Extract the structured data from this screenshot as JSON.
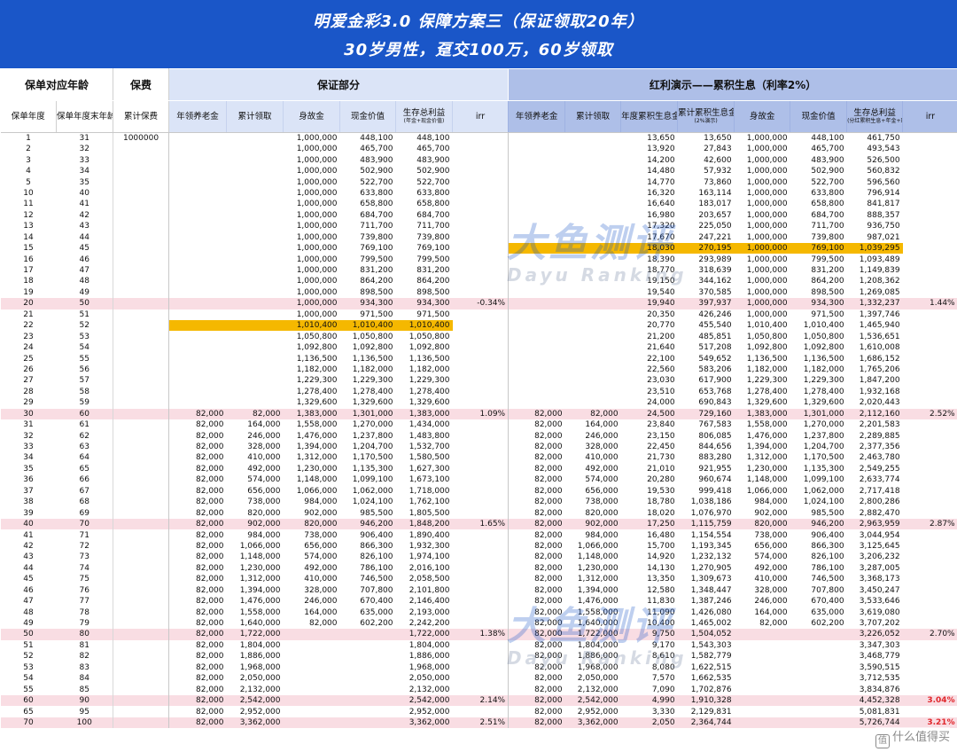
{
  "title": {
    "line1": "明爱金彩3.0  保障方案三（保证领取20年）",
    "line2": "30岁男性，趸交100万，60岁领取"
  },
  "groups": {
    "age": "保单对应年龄",
    "premium": "保费",
    "guaranteed": "保证部分",
    "dividend": "红利演示——累积生息（利率2%）"
  },
  "headers": [
    {
      "label": "保单年度"
    },
    {
      "label": "保单年度末年龄"
    },
    {
      "label": "累计保费"
    },
    {
      "label": "年领养老金"
    },
    {
      "label": "累计领取"
    },
    {
      "label": "身故金"
    },
    {
      "label": "现金价值"
    },
    {
      "label": "生存总利益",
      "sub": "(年金+现金价值)"
    },
    {
      "label": "irr"
    },
    {
      "label": "年领养老金"
    },
    {
      "label": "累计领取"
    },
    {
      "label": "年度累积生息金额"
    },
    {
      "label": "累计累积生息金额",
      "sub": "(2%演示)"
    },
    {
      "label": "身故金"
    },
    {
      "label": "现金价值"
    },
    {
      "label": "生存总利益",
      "sub": "(分红累积生息+年金+现价)"
    },
    {
      "label": "irr"
    }
  ],
  "rows": [
    [
      "1",
      "31",
      "1000000",
      "",
      "",
      "1,000,000",
      "448,100",
      "448,100",
      "",
      "",
      "",
      "13,650",
      "13,650",
      "1,000,000",
      "448,100",
      "461,750",
      ""
    ],
    [
      "2",
      "32",
      "",
      "",
      "",
      "1,000,000",
      "465,700",
      "465,700",
      "",
      "",
      "",
      "13,920",
      "27,843",
      "1,000,000",
      "465,700",
      "493,543",
      ""
    ],
    [
      "3",
      "33",
      "",
      "",
      "",
      "1,000,000",
      "483,900",
      "483,900",
      "",
      "",
      "",
      "14,200",
      "42,600",
      "1,000,000",
      "483,900",
      "526,500",
      ""
    ],
    [
      "4",
      "34",
      "",
      "",
      "",
      "1,000,000",
      "502,900",
      "502,900",
      "",
      "",
      "",
      "14,480",
      "57,932",
      "1,000,000",
      "502,900",
      "560,832",
      ""
    ],
    [
      "5",
      "35",
      "",
      "",
      "",
      "1,000,000",
      "522,700",
      "522,700",
      "",
      "",
      "",
      "14,770",
      "73,860",
      "1,000,000",
      "522,700",
      "596,560",
      ""
    ],
    [
      "10",
      "40",
      "",
      "",
      "",
      "1,000,000",
      "633,800",
      "633,800",
      "",
      "",
      "",
      "16,320",
      "163,114",
      "1,000,000",
      "633,800",
      "796,914",
      ""
    ],
    [
      "11",
      "41",
      "",
      "",
      "",
      "1,000,000",
      "658,800",
      "658,800",
      "",
      "",
      "",
      "16,640",
      "183,017",
      "1,000,000",
      "658,800",
      "841,817",
      ""
    ],
    [
      "12",
      "42",
      "",
      "",
      "",
      "1,000,000",
      "684,700",
      "684,700",
      "",
      "",
      "",
      "16,980",
      "203,657",
      "1,000,000",
      "684,700",
      "888,357",
      ""
    ],
    [
      "13",
      "43",
      "",
      "",
      "",
      "1,000,000",
      "711,700",
      "711,700",
      "",
      "",
      "",
      "17,320",
      "225,050",
      "1,000,000",
      "711,700",
      "936,750",
      ""
    ],
    [
      "14",
      "44",
      "",
      "",
      "",
      "1,000,000",
      "739,800",
      "739,800",
      "",
      "",
      "",
      "17,670",
      "247,221",
      "1,000,000",
      "739,800",
      "987,021",
      ""
    ],
    [
      "15",
      "45",
      "",
      "",
      "",
      "1,000,000",
      "769,100",
      "769,100",
      "",
      "",
      "",
      "18,030",
      "270,195",
      "1,000,000",
      "769,100",
      "1,039,295",
      ""
    ],
    [
      "16",
      "46",
      "",
      "",
      "",
      "1,000,000",
      "799,500",
      "799,500",
      "",
      "",
      "",
      "18,390",
      "293,989",
      "1,000,000",
      "799,500",
      "1,093,489",
      ""
    ],
    [
      "17",
      "47",
      "",
      "",
      "",
      "1,000,000",
      "831,200",
      "831,200",
      "",
      "",
      "",
      "18,770",
      "318,639",
      "1,000,000",
      "831,200",
      "1,149,839",
      ""
    ],
    [
      "18",
      "48",
      "",
      "",
      "",
      "1,000,000",
      "864,200",
      "864,200",
      "",
      "",
      "",
      "19,150",
      "344,162",
      "1,000,000",
      "864,200",
      "1,208,362",
      ""
    ],
    [
      "19",
      "49",
      "",
      "",
      "",
      "1,000,000",
      "898,500",
      "898,500",
      "",
      "",
      "",
      "19,540",
      "370,585",
      "1,000,000",
      "898,500",
      "1,269,085",
      ""
    ],
    [
      "20",
      "50",
      "",
      "",
      "",
      "1,000,000",
      "934,300",
      "934,300",
      "-0.34%",
      "",
      "",
      "19,940",
      "397,937",
      "1,000,000",
      "934,300",
      "1,332,237",
      "1.44%"
    ],
    [
      "21",
      "51",
      "",
      "",
      "",
      "1,000,000",
      "971,500",
      "971,500",
      "",
      "",
      "",
      "20,350",
      "426,246",
      "1,000,000",
      "971,500",
      "1,397,746",
      ""
    ],
    [
      "22",
      "52",
      "",
      "",
      "",
      "1,010,400",
      "1,010,400",
      "1,010,400",
      "",
      "",
      "",
      "20,770",
      "455,540",
      "1,010,400",
      "1,010,400",
      "1,465,940",
      ""
    ],
    [
      "23",
      "53",
      "",
      "",
      "",
      "1,050,800",
      "1,050,800",
      "1,050,800",
      "",
      "",
      "",
      "21,200",
      "485,851",
      "1,050,800",
      "1,050,800",
      "1,536,651",
      ""
    ],
    [
      "24",
      "54",
      "",
      "",
      "",
      "1,092,800",
      "1,092,800",
      "1,092,800",
      "",
      "",
      "",
      "21,640",
      "517,208",
      "1,092,800",
      "1,092,800",
      "1,610,008",
      ""
    ],
    [
      "25",
      "55",
      "",
      "",
      "",
      "1,136,500",
      "1,136,500",
      "1,136,500",
      "",
      "",
      "",
      "22,100",
      "549,652",
      "1,136,500",
      "1,136,500",
      "1,686,152",
      ""
    ],
    [
      "26",
      "56",
      "",
      "",
      "",
      "1,182,000",
      "1,182,000",
      "1,182,000",
      "",
      "",
      "",
      "22,560",
      "583,206",
      "1,182,000",
      "1,182,000",
      "1,765,206",
      ""
    ],
    [
      "27",
      "57",
      "",
      "",
      "",
      "1,229,300",
      "1,229,300",
      "1,229,300",
      "",
      "",
      "",
      "23,030",
      "617,900",
      "1,229,300",
      "1,229,300",
      "1,847,200",
      ""
    ],
    [
      "28",
      "58",
      "",
      "",
      "",
      "1,278,400",
      "1,278,400",
      "1,278,400",
      "",
      "",
      "",
      "23,510",
      "653,768",
      "1,278,400",
      "1,278,400",
      "1,932,168",
      ""
    ],
    [
      "29",
      "59",
      "",
      "",
      "",
      "1,329,600",
      "1,329,600",
      "1,329,600",
      "",
      "",
      "",
      "24,000",
      "690,843",
      "1,329,600",
      "1,329,600",
      "2,020,443",
      ""
    ],
    [
      "30",
      "60",
      "",
      "82,000",
      "82,000",
      "1,383,000",
      "1,301,000",
      "1,383,000",
      "1.09%",
      "82,000",
      "82,000",
      "24,500",
      "729,160",
      "1,383,000",
      "1,301,000",
      "2,112,160",
      "2.52%"
    ],
    [
      "31",
      "61",
      "",
      "82,000",
      "164,000",
      "1,558,000",
      "1,270,000",
      "1,434,000",
      "",
      "82,000",
      "164,000",
      "23,840",
      "767,583",
      "1,558,000",
      "1,270,000",
      "2,201,583",
      ""
    ],
    [
      "32",
      "62",
      "",
      "82,000",
      "246,000",
      "1,476,000",
      "1,237,800",
      "1,483,800",
      "",
      "82,000",
      "246,000",
      "23,150",
      "806,085",
      "1,476,000",
      "1,237,800",
      "2,289,885",
      ""
    ],
    [
      "33",
      "63",
      "",
      "82,000",
      "328,000",
      "1,394,000",
      "1,204,700",
      "1,532,700",
      "",
      "82,000",
      "328,000",
      "22,450",
      "844,656",
      "1,394,000",
      "1,204,700",
      "2,377,356",
      ""
    ],
    [
      "34",
      "64",
      "",
      "82,000",
      "410,000",
      "1,312,000",
      "1,170,500",
      "1,580,500",
      "",
      "82,000",
      "410,000",
      "21,730",
      "883,280",
      "1,312,000",
      "1,170,500",
      "2,463,780",
      ""
    ],
    [
      "35",
      "65",
      "",
      "82,000",
      "492,000",
      "1,230,000",
      "1,135,300",
      "1,627,300",
      "",
      "82,000",
      "492,000",
      "21,010",
      "921,955",
      "1,230,000",
      "1,135,300",
      "2,549,255",
      ""
    ],
    [
      "36",
      "66",
      "",
      "82,000",
      "574,000",
      "1,148,000",
      "1,099,100",
      "1,673,100",
      "",
      "82,000",
      "574,000",
      "20,280",
      "960,674",
      "1,148,000",
      "1,099,100",
      "2,633,774",
      ""
    ],
    [
      "37",
      "67",
      "",
      "82,000",
      "656,000",
      "1,066,000",
      "1,062,000",
      "1,718,000",
      "",
      "82,000",
      "656,000",
      "19,530",
      "999,418",
      "1,066,000",
      "1,062,000",
      "2,717,418",
      ""
    ],
    [
      "38",
      "68",
      "",
      "82,000",
      "738,000",
      "984,000",
      "1,024,100",
      "1,762,100",
      "",
      "82,000",
      "738,000",
      "18,780",
      "1,038,186",
      "984,000",
      "1,024,100",
      "2,800,286",
      ""
    ],
    [
      "39",
      "69",
      "",
      "82,000",
      "820,000",
      "902,000",
      "985,500",
      "1,805,500",
      "",
      "82,000",
      "820,000",
      "18,020",
      "1,076,970",
      "902,000",
      "985,500",
      "2,882,470",
      ""
    ],
    [
      "40",
      "70",
      "",
      "82,000",
      "902,000",
      "820,000",
      "946,200",
      "1,848,200",
      "1.65%",
      "82,000",
      "902,000",
      "17,250",
      "1,115,759",
      "820,000",
      "946,200",
      "2,963,959",
      "2.87%"
    ],
    [
      "41",
      "71",
      "",
      "82,000",
      "984,000",
      "738,000",
      "906,400",
      "1,890,400",
      "",
      "82,000",
      "984,000",
      "16,480",
      "1,154,554",
      "738,000",
      "906,400",
      "3,044,954",
      ""
    ],
    [
      "42",
      "72",
      "",
      "82,000",
      "1,066,000",
      "656,000",
      "866,300",
      "1,932,300",
      "",
      "82,000",
      "1,066,000",
      "15,700",
      "1,193,345",
      "656,000",
      "866,300",
      "3,125,645",
      ""
    ],
    [
      "43",
      "73",
      "",
      "82,000",
      "1,148,000",
      "574,000",
      "826,100",
      "1,974,100",
      "",
      "82,000",
      "1,148,000",
      "14,920",
      "1,232,132",
      "574,000",
      "826,100",
      "3,206,232",
      ""
    ],
    [
      "44",
      "74",
      "",
      "82,000",
      "1,230,000",
      "492,000",
      "786,100",
      "2,016,100",
      "",
      "82,000",
      "1,230,000",
      "14,130",
      "1,270,905",
      "492,000",
      "786,100",
      "3,287,005",
      ""
    ],
    [
      "45",
      "75",
      "",
      "82,000",
      "1,312,000",
      "410,000",
      "746,500",
      "2,058,500",
      "",
      "82,000",
      "1,312,000",
      "13,350",
      "1,309,673",
      "410,000",
      "746,500",
      "3,368,173",
      ""
    ],
    [
      "46",
      "76",
      "",
      "82,000",
      "1,394,000",
      "328,000",
      "707,800",
      "2,101,800",
      "",
      "82,000",
      "1,394,000",
      "12,580",
      "1,348,447",
      "328,000",
      "707,800",
      "3,450,247",
      ""
    ],
    [
      "47",
      "77",
      "",
      "82,000",
      "1,476,000",
      "246,000",
      "670,400",
      "2,146,400",
      "",
      "82,000",
      "1,476,000",
      "11,830",
      "1,387,246",
      "246,000",
      "670,400",
      "3,533,646",
      ""
    ],
    [
      "48",
      "78",
      "",
      "82,000",
      "1,558,000",
      "164,000",
      "635,000",
      "2,193,000",
      "",
      "82,000",
      "1,558,000",
      "11,090",
      "1,426,080",
      "164,000",
      "635,000",
      "3,619,080",
      ""
    ],
    [
      "49",
      "79",
      "",
      "82,000",
      "1,640,000",
      "82,000",
      "602,200",
      "2,242,200",
      "",
      "82,000",
      "1,640,000",
      "10,400",
      "1,465,002",
      "82,000",
      "602,200",
      "3,707,202",
      ""
    ],
    [
      "50",
      "80",
      "",
      "82,000",
      "1,722,000",
      "",
      "",
      "1,722,000",
      "1.38%",
      "82,000",
      "1,722,000",
      "9,750",
      "1,504,052",
      "",
      "",
      "3,226,052",
      "2.70%"
    ],
    [
      "51",
      "81",
      "",
      "82,000",
      "1,804,000",
      "",
      "",
      "1,804,000",
      "",
      "82,000",
      "1,804,000",
      "9,170",
      "1,543,303",
      "",
      "",
      "3,347,303",
      ""
    ],
    [
      "52",
      "82",
      "",
      "82,000",
      "1,886,000",
      "",
      "",
      "1,886,000",
      "",
      "82,000",
      "1,886,000",
      "8,610",
      "1,582,779",
      "",
      "",
      "3,468,779",
      ""
    ],
    [
      "53",
      "83",
      "",
      "82,000",
      "1,968,000",
      "",
      "",
      "1,968,000",
      "",
      "82,000",
      "1,968,000",
      "8,080",
      "1,622,515",
      "",
      "",
      "3,590,515",
      ""
    ],
    [
      "54",
      "84",
      "",
      "82,000",
      "2,050,000",
      "",
      "",
      "2,050,000",
      "",
      "82,000",
      "2,050,000",
      "7,570",
      "1,662,535",
      "",
      "",
      "3,712,535",
      ""
    ],
    [
      "55",
      "85",
      "",
      "82,000",
      "2,132,000",
      "",
      "",
      "2,132,000",
      "",
      "82,000",
      "2,132,000",
      "7,090",
      "1,702,876",
      "",
      "",
      "3,834,876",
      ""
    ],
    [
      "60",
      "90",
      "",
      "82,000",
      "2,542,000",
      "",
      "",
      "2,542,000",
      "2.14%",
      "82,000",
      "2,542,000",
      "4,990",
      "1,910,328",
      "",
      "",
      "4,452,328",
      "3.04%"
    ],
    [
      "65",
      "95",
      "",
      "82,000",
      "2,952,000",
      "",
      "",
      "2,952,000",
      "",
      "82,000",
      "2,952,000",
      "3,330",
      "2,129,831",
      "",
      "",
      "5,081,831",
      ""
    ],
    [
      "70",
      "100",
      "",
      "82,000",
      "3,362,000",
      "",
      "",
      "3,362,000",
      "2.51%",
      "82,000",
      "3,362,000",
      "2,050",
      "2,364,744",
      "",
      "",
      "5,726,744",
      "3.21%"
    ]
  ],
  "highlight_rows": [
    15,
    25,
    35,
    45,
    51,
    53
  ],
  "watermark": {
    "cn": "大鱼测评",
    "en": "Dayu Ranking"
  },
  "corner_logo": {
    "icon": "值",
    "text": "什么值得买"
  },
  "colors": {
    "title_bg": "#1a56c8",
    "highlight_row": "#f9dde3",
    "highlight_cell": "#f5b800",
    "irr_red": "#e0262b"
  }
}
